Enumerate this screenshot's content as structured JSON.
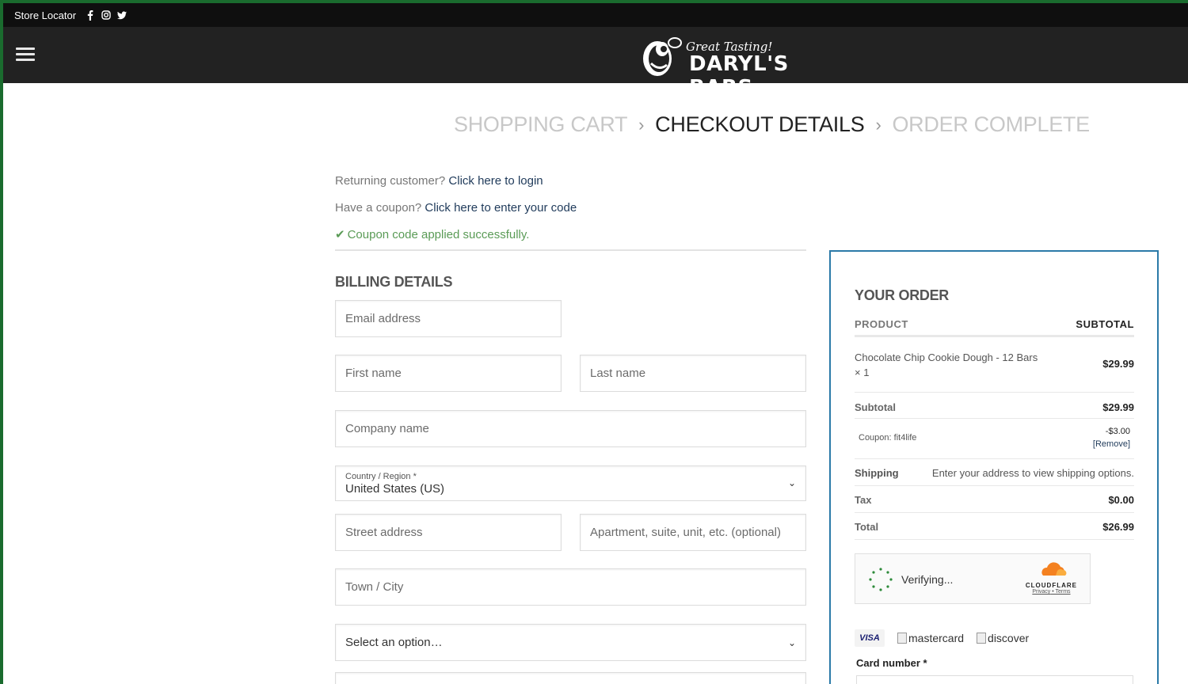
{
  "topbar": {
    "store_locator": "Store Locator",
    "social": [
      "facebook-icon",
      "instagram-icon",
      "twitter-icon"
    ]
  },
  "header": {
    "tagline": "Great Tasting!",
    "brand": "DARYL'S BARS"
  },
  "steps": {
    "cart": "SHOPPING CART",
    "checkout": "CHECKOUT DETAILS",
    "complete": "ORDER COMPLETE"
  },
  "notices": {
    "returning_prefix": "Returning customer?",
    "returning_link": "Click here to login",
    "coupon_prefix": "Have a coupon?",
    "coupon_link": "Click here to enter your code",
    "coupon_success": "Coupon code applied successfully."
  },
  "billing": {
    "title": "BILLING DETAILS",
    "email": "Email address",
    "first_name": "First name",
    "last_name": "Last name",
    "company": "Company name",
    "country_label": "Country / Region *",
    "country_value": "United States (US)",
    "street": "Street address",
    "apartment": "Apartment, suite, unit, etc. (optional)",
    "city": "Town / City",
    "state_select": "Select an option…"
  },
  "order": {
    "title": "YOUR ORDER",
    "col_product": "PRODUCT",
    "col_subtotal": "SUBTOTAL",
    "item_name": "Chocolate Chip Cookie Dough - 12 Bars",
    "item_qty": "× 1",
    "item_price": "$29.99",
    "subtotal_label": "Subtotal",
    "subtotal_value": "$29.99",
    "coupon_label": "Coupon: fit4life",
    "coupon_value": "-$3.00",
    "coupon_remove": "[Remove]",
    "shipping_label": "Shipping",
    "shipping_value": "Enter your address to view shipping options.",
    "tax_label": "Tax",
    "tax_value": "$0.00",
    "total_label": "Total",
    "total_value": "$26.99"
  },
  "turnstile": {
    "status": "Verifying...",
    "brand": "CLOUDFLARE",
    "privacy": "Privacy",
    "terms": "Terms"
  },
  "payment": {
    "visa": "VISA",
    "mastercard": "mastercard",
    "discover": "discover",
    "card_number_label": "Card number *"
  },
  "colors": {
    "topbar": "#0f0f0f",
    "header": "#222222",
    "accent_border": "#2b7aa8",
    "success": "#5a9b56",
    "link": "#1f3a5a"
  }
}
